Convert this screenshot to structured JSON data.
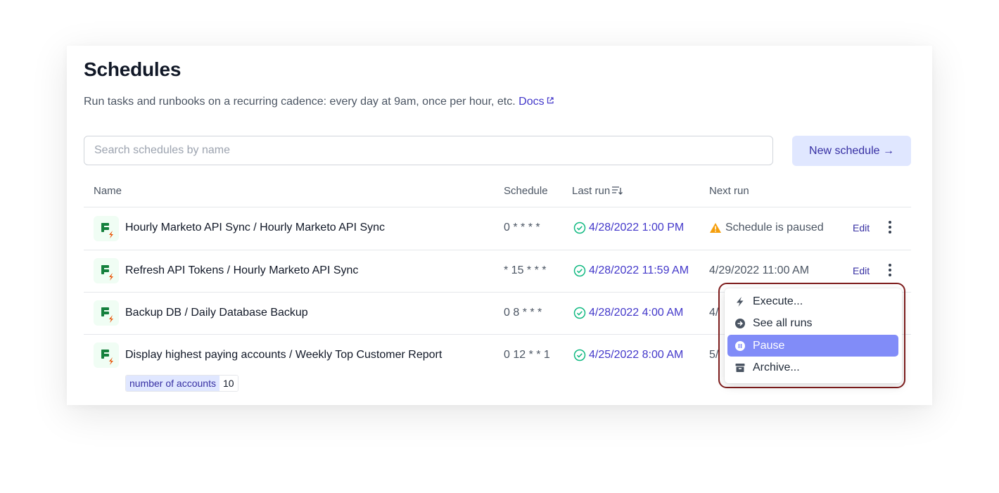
{
  "page": {
    "title": "Schedules",
    "subtitle": "Run tasks and runbooks on a recurring cadence: every day at 9am, once per hour, etc.",
    "docs_label": "Docs"
  },
  "search": {
    "placeholder": "Search schedules by name",
    "value": ""
  },
  "new_schedule_label": "New schedule →",
  "table": {
    "headers": {
      "name": "Name",
      "schedule": "Schedule",
      "last_run": "Last run",
      "next_run": "Next run"
    },
    "edit_label": "Edit",
    "rows": [
      {
        "name": "Hourly Marketo API Sync / Hourly Marketo API Sync",
        "schedule": "0 * * * *",
        "last_run": "4/28/2022 1:00 PM",
        "next_run": "Schedule is paused"
      },
      {
        "name": "Refresh API Tokens / Hourly Marketo API Sync",
        "schedule": "* 15 * * *",
        "last_run": "4/28/2022 11:59 AM",
        "next_run": "4/29/2022 11:00 AM"
      },
      {
        "name": "Backup DB / Daily Database Backup",
        "schedule": "0 8 * * *",
        "last_run": "4/28/2022 4:00 AM",
        "next_run": "4/"
      },
      {
        "name": "Display highest paying accounts / Weekly Top Customer Report",
        "schedule": "0 12 * * 1",
        "last_run": "4/25/2022 8:00 AM",
        "next_run": "5/",
        "param_key": "number of accounts",
        "param_value": "10"
      }
    ]
  },
  "menu": {
    "items": [
      {
        "label": "Execute...",
        "icon": "bolt-icon"
      },
      {
        "label": "See all runs",
        "icon": "arrow-circle-icon"
      },
      {
        "label": "Pause",
        "icon": "pause-circle-icon",
        "active": true
      },
      {
        "label": "Archive...",
        "icon": "archive-icon"
      }
    ]
  },
  "colors": {
    "accent": "#4338ca",
    "accent_light": "#e0e7ff",
    "menu_active": "#818cf8",
    "success": "#10b981",
    "warning": "#f59e0b",
    "highlight_outline": "#7f1d1d"
  }
}
